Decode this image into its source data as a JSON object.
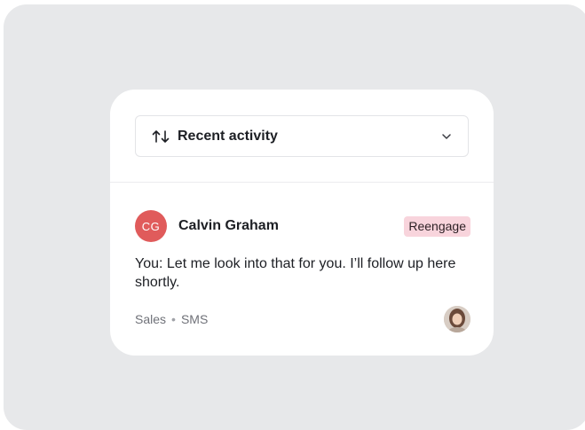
{
  "sort_select": {
    "icon": "sort-arrows-icon",
    "label": "Recent activity",
    "chevron": "chevron-down-icon"
  },
  "conversation": {
    "initials": "CG",
    "avatar_color": "#e05b5b",
    "name": "Calvin Graham",
    "badge": "Reengage",
    "badge_color": "#f8d4dc",
    "message": "You: Let me look into that for you. I’ll follow up here shortly.",
    "meta": {
      "team": "Sales",
      "separator": "•",
      "channel": "SMS"
    },
    "assignee_avatar": "user-photo-avatar"
  }
}
